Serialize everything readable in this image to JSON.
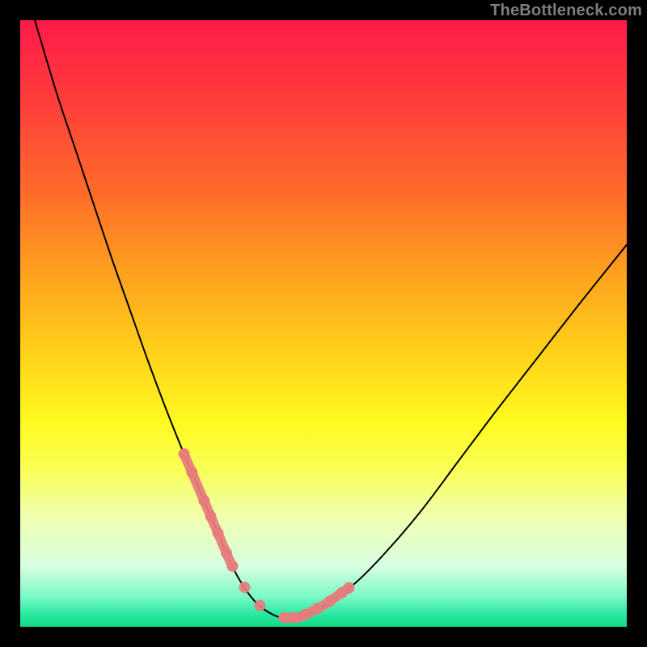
{
  "watermark": "TheBottleneck.com",
  "colors": {
    "frame": "#000000",
    "curve": "#000000",
    "highlight": "#e77c7c",
    "gradient_top": "#ff1a4a",
    "gradient_bottom": "#14d983"
  },
  "chart_data": {
    "type": "line",
    "title": "",
    "xlabel": "",
    "ylabel": "",
    "xlim": [
      0,
      100
    ],
    "ylim": [
      0,
      100
    ],
    "annotations": [
      "TheBottleneck.com"
    ],
    "legend": false,
    "grid": false,
    "series": [
      {
        "name": "bottleneck-curve",
        "x": [
          0,
          3,
          6,
          9,
          12,
          15,
          18,
          21,
          24,
          27,
          30,
          31.5,
          33,
          34.5,
          36,
          38,
          40,
          43,
          46,
          50,
          55,
          60,
          66,
          72,
          78,
          85,
          92,
          100
        ],
        "y": [
          108,
          98,
          88,
          79,
          70,
          61,
          52.5,
          44,
          36,
          28.5,
          21.5,
          18,
          14.5,
          11,
          8,
          5,
          3,
          1.5,
          1.5,
          3.5,
          7,
          12,
          19,
          27,
          35,
          44,
          53,
          63
        ],
        "note": "y is relative height in % where 0 = bottom of plot, 100 = top edge of plot; values >100 indicate curve starts above visible area"
      }
    ],
    "highlight_segments": [
      {
        "name": "left-arm",
        "x_from": 27,
        "x_to": 35
      },
      {
        "name": "right-arm",
        "x_from": 43.5,
        "x_to": 54
      }
    ],
    "highlight_dots_x": [
      27,
      28.3,
      30.3,
      31.4,
      32.6,
      34.0,
      35.0,
      37.0,
      39.5,
      43.5,
      45.2,
      47.0,
      49.0,
      51.0,
      53.0,
      54.2
    ]
  }
}
